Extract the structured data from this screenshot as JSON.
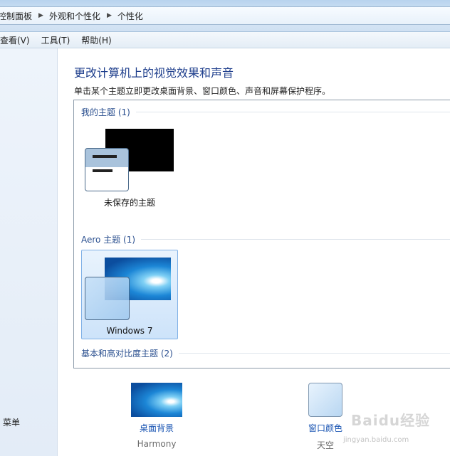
{
  "address_bar": {
    "crumbs": [
      "控制面板",
      "外观和个性化",
      "个性化"
    ]
  },
  "menu": [
    "查看(V)",
    "工具(T)",
    "帮助(H)"
  ],
  "leftnav": {
    "bottom_link": "菜单"
  },
  "main": {
    "title": "更改计算机上的视觉效果和声音",
    "subtitle": "单击某个主题立即更改桌面背景、窗口颜色、声音和屏幕保护程序。"
  },
  "theme_groups": {
    "my_themes": {
      "header": "我的主题 (1)",
      "item_label": "未保存的主题"
    },
    "aero_themes": {
      "header": "Aero 主题 (1)",
      "item_label": "Windows 7"
    },
    "basic_themes": {
      "header": "基本和高对比度主题 (2)"
    }
  },
  "options": {
    "desktop_background": {
      "label": "桌面背景",
      "value": "Harmony"
    },
    "window_color": {
      "label": "窗口颜色",
      "value": "天空"
    }
  },
  "watermark": {
    "text": "Baidu经验",
    "url_text": "jingyan.baidu.com"
  },
  "colors": {
    "accent": "#1e3e8c",
    "link": "#1a55b3",
    "group": "#2a4f8f"
  }
}
